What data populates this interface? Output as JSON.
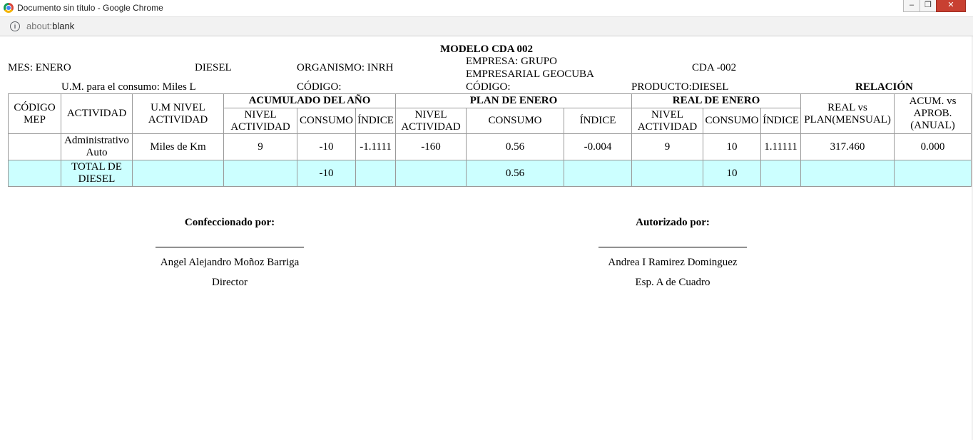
{
  "window": {
    "title": "Documento sin título - Google Chrome",
    "url_scheme": "about:",
    "url_path": "blank"
  },
  "report": {
    "title": "MODELO CDA 002",
    "mes": "MES: ENERO",
    "combustible": "DIESEL",
    "organismo": "ORGANISMO: INRH",
    "empresa_line1": "EMPRESA: GRUPO",
    "empresa_line2": "EMPRESARIAL GEOCUBA",
    "cda": "CDA -002",
    "um_consumo": "U.M. para el consumo: Miles L",
    "codigo1": "CÓDIGO:",
    "codigo2": "CÓDIGO:",
    "producto": "PRODUCTO:DIESEL",
    "relacion": "RELACIÓN"
  },
  "table": {
    "headers": {
      "codigo_mep": "CÓDIGO MEP",
      "actividad": "ACTIVIDAD",
      "um_nivel": "U.M NIVEL ACTIVIDAD",
      "acumulado": "ACUMULADO DEL AÑO",
      "plan": "PLAN DE ENERO",
      "real": "REAL DE ENERO",
      "real_vs_plan": "REAL vs PLAN(MENSUAL)",
      "acum_vs_aprob": "ACUM. vs APROB. (ANUAL)",
      "nivel_actividad": "NIVEL ACTIVIDAD",
      "consumo": "CONSUMO",
      "indice": "ÍNDICE"
    },
    "row": {
      "codigo_mep": "",
      "actividad": "Administrativo Auto",
      "um": "Miles de Km",
      "acum_nivel": "9",
      "acum_consumo": "-10",
      "acum_indice": "-1.1111",
      "plan_nivel": "-160",
      "plan_consumo": "0.56",
      "plan_indice": "-0.004",
      "real_nivel": "9",
      "real_consumo": "10",
      "real_indice": "1.11111",
      "real_vs_plan": "317.460",
      "acum_vs_aprob": "0.000"
    },
    "total": {
      "label": "TOTAL DE DIESEL",
      "acum_consumo": "-10",
      "plan_consumo": "0.56",
      "real_consumo": "10"
    },
    "total_row_color": "#ccffff"
  },
  "signatures": {
    "left": {
      "heading": "Confeccionado por:",
      "name": "Angel Alejandro Moñoz Barriga",
      "role": "Director"
    },
    "right": {
      "heading": "Autorizado por:",
      "name": "Andrea I Ramirez Dominguez",
      "role": "Esp. A de Cuadro"
    }
  }
}
